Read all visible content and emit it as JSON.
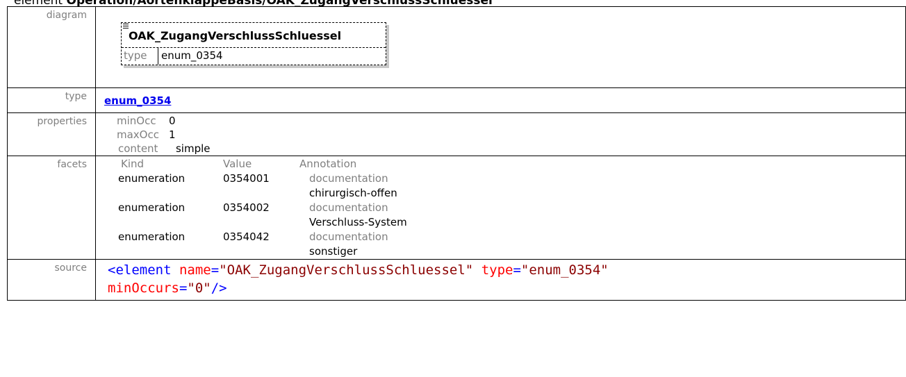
{
  "header": {
    "prefix": "element ",
    "path": "Operation/AortenklappeBasis/OAK_ZugangVerschlussSchluessel"
  },
  "labels": {
    "diagram": "diagram",
    "type": "type",
    "properties": "properties",
    "facets": "facets",
    "source": "source"
  },
  "diagram": {
    "title": "OAK_ZugangVerschlussSchluessel",
    "type_label": "type",
    "type_value": "enum_0354"
  },
  "type_link": "enum_0354",
  "properties": [
    {
      "key": "minOcc",
      "value": "0"
    },
    {
      "key": "maxOcc",
      "value": "1"
    },
    {
      "key": "content",
      "value": "simple"
    }
  ],
  "facets": {
    "headers": {
      "kind": "Kind",
      "value": "Value",
      "annotation": "Annotation"
    },
    "rows": [
      {
        "kind": "enumeration",
        "value": "0354001",
        "doc_label": "documentation",
        "doc_text": "chirurgisch-offen"
      },
      {
        "kind": "enumeration",
        "value": "0354002",
        "doc_label": "documentation",
        "doc_text": "Verschluss-System"
      },
      {
        "kind": "enumeration",
        "value": "0354042",
        "doc_label": "documentation",
        "doc_text": "sonstiger"
      }
    ]
  },
  "source": {
    "open": "<element",
    "name_attr": "name",
    "name_val": "\"OAK_ZugangVerschlussSchluessel\"",
    "type_attr": "type",
    "type_val": "\"enum_0354\"",
    "minocc_attr": "minOccurs",
    "minocc_val": "\"0\"",
    "close": "/>",
    "eq": "="
  }
}
